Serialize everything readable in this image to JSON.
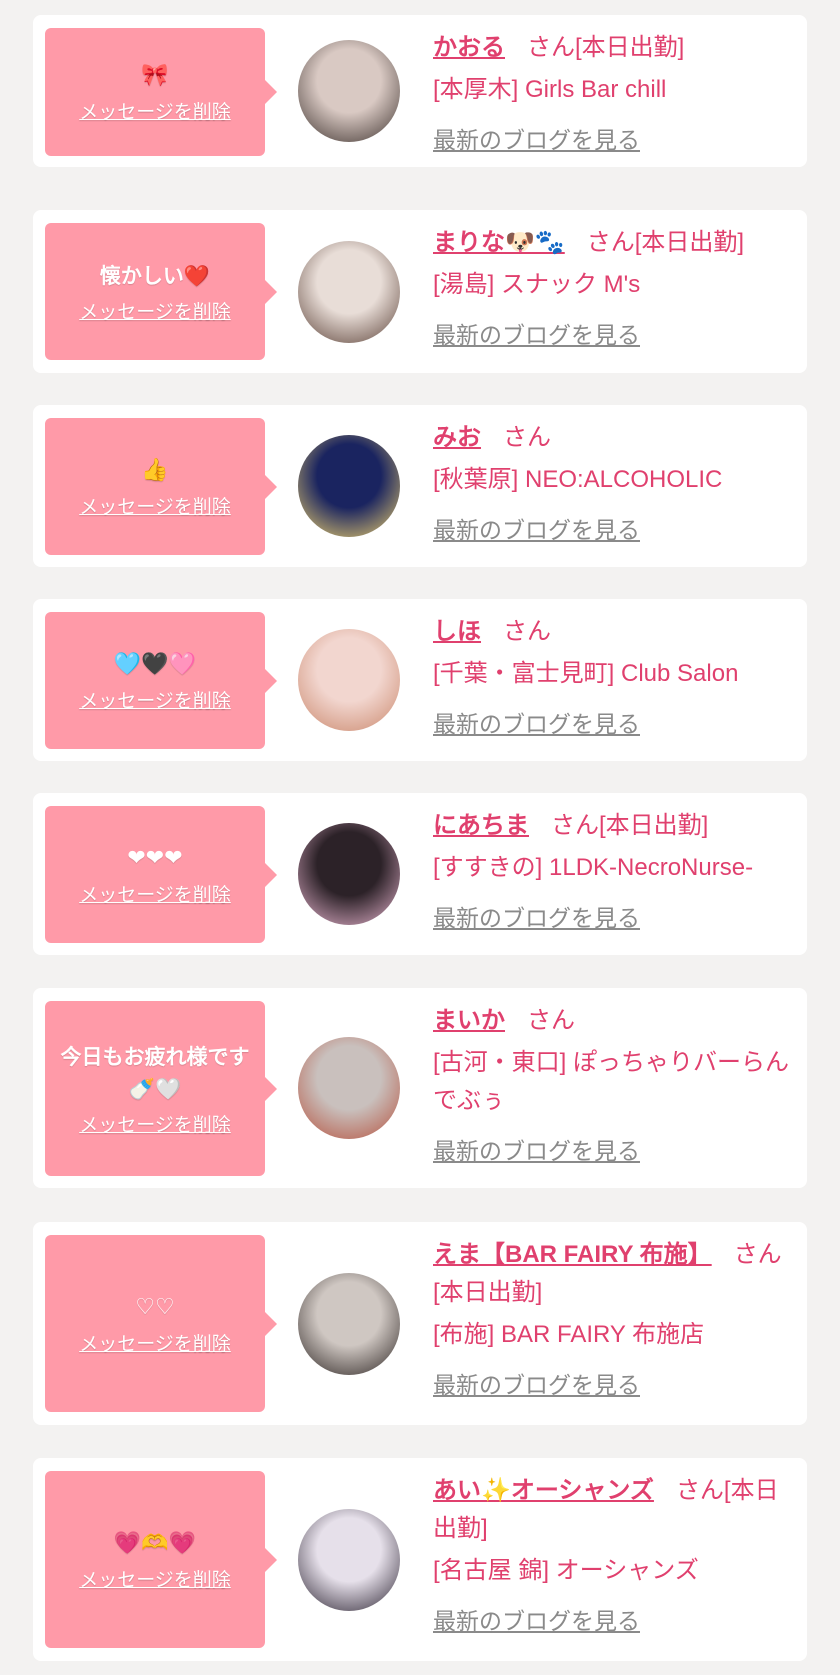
{
  "cards": [
    {
      "message": "🎀",
      "delete_label": "メッセージを削除",
      "name": "かおる",
      "suffix": "さん[本日出勤]",
      "store": "[本厚木] Girls Bar chill",
      "blog_link": "最新のブログを見る"
    },
    {
      "message": "懐かしい❤️",
      "delete_label": "メッセージを削除",
      "name": "まりな🐶🐾",
      "suffix": "さん[本日出勤]",
      "store": "[湯島] スナック M's",
      "blog_link": "最新のブログを見る"
    },
    {
      "message": "👍",
      "delete_label": "メッセージを削除",
      "name": "みお",
      "suffix": "さん",
      "store": "[秋葉原] NEO:ALCOHOLIC",
      "blog_link": "最新のブログを見る"
    },
    {
      "message": "🩵🖤🩷",
      "delete_label": "メッセージを削除",
      "name": "しほ",
      "suffix": "さん",
      "store": "[千葉・富士見町] Club Salon",
      "blog_link": "最新のブログを見る"
    },
    {
      "message": "❤❤❤",
      "delete_label": "メッセージを削除",
      "name": "にあちま",
      "suffix": "さん[本日出勤]",
      "store": "[すすきの] 1LDK-NecroNurse-",
      "blog_link": "最新のブログを見る"
    },
    {
      "message": "今日もお疲れ様です🍼🤍",
      "delete_label": "メッセージを削除",
      "name": "まいか",
      "suffix": "さん",
      "store": "[古河・東口] ぽっちゃりバーらんでぶぅ",
      "blog_link": "最新のブログを見る"
    },
    {
      "message": "♡♡",
      "delete_label": "メッセージを削除",
      "name": "えま【BAR FAIRY 布施】",
      "suffix": "さん[本日出勤]",
      "store": "[布施] BAR FAIRY 布施店",
      "blog_link": "最新のブログを見る"
    },
    {
      "message": "💗🫶💗",
      "delete_label": "メッセージを削除",
      "name": "あい✨オーシャンズ",
      "suffix": "さん[本日出勤]",
      "store": "[名古屋 錦] オーシャンズ",
      "blog_link": "最新のブログを見る"
    }
  ],
  "colors": {
    "accent": "#e0406e",
    "bubble": "#ff9aa8",
    "background": "#f3f2f1",
    "link_gray": "#8a8a8a"
  }
}
